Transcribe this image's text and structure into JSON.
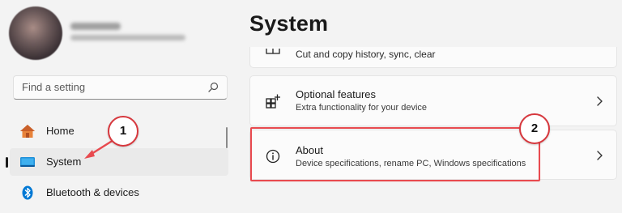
{
  "sidebar": {
    "search_placeholder": "Find a setting",
    "items": [
      {
        "label": "Home",
        "icon": "home-icon"
      },
      {
        "label": "System",
        "icon": "system-display-icon",
        "selected": true
      },
      {
        "label": "Bluetooth & devices",
        "icon": "bluetooth-icon"
      }
    ]
  },
  "main": {
    "title": "System",
    "cards": [
      {
        "title": "",
        "subtitle": "Cut and copy history, sync, clear",
        "icon": "clipboard-icon"
      },
      {
        "title": "Optional features",
        "subtitle": "Extra functionality for your device",
        "icon": "add-features-icon"
      },
      {
        "title": "About",
        "subtitle": "Device specifications, rename PC, Windows specifications",
        "icon": "info-icon"
      }
    ]
  },
  "annotations": {
    "step1": "1",
    "step2": "2",
    "color": "#e84a4f"
  },
  "colors": {
    "accent_blue": "#0067c0",
    "home_orange": "#e8833a",
    "background": "#f3f3f3"
  }
}
